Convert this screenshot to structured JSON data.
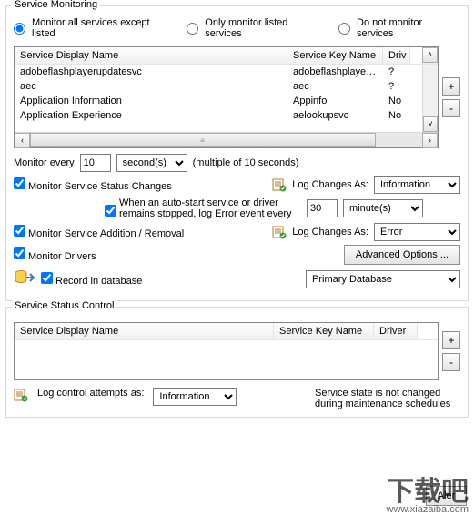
{
  "monitoring": {
    "legend": "Service Monitoring",
    "radios": {
      "except": "Monitor all services except listed",
      "only": "Only monitor listed services",
      "none": "Do not monitor services"
    },
    "table": {
      "headers": {
        "name": "Service Display Name",
        "key": "Service Key Name",
        "driver": "Driv"
      },
      "rows": [
        {
          "name": "adobeflashplayerupdatesvc",
          "key": "adobeflashplayerupd...",
          "driver": "?"
        },
        {
          "name": "aec",
          "key": "aec",
          "driver": "?"
        },
        {
          "name": "Application Information",
          "key": "Appinfo",
          "driver": "No"
        },
        {
          "name": "Application Experience",
          "key": "aelookupsvc",
          "driver": "No"
        }
      ]
    },
    "interval": {
      "label_before": "Monitor every",
      "value": "10",
      "unit": "second(s)",
      "label_after": "(multiple of 10 seconds)"
    },
    "status_changes": {
      "label": "Monitor Service Status Changes",
      "log_label": "Log Changes As:",
      "log_level": "Information"
    },
    "autostart": {
      "label": "When an auto-start service or driver remains stopped, log Error event every",
      "value": "30",
      "unit": "minute(s)"
    },
    "add_remove": {
      "label": "Monitor Service Addition / Removal",
      "log_label": "Log Changes As:",
      "log_level": "Error"
    },
    "drivers": {
      "label": "Monitor Drivers"
    },
    "advanced_btn": "Advanced Options ...",
    "record_db": {
      "label": "Record in database",
      "db": "Primary Database"
    }
  },
  "status_control": {
    "legend": "Service Status Control",
    "table": {
      "headers": {
        "name": "Service Display Name",
        "key": "Service Key Name",
        "driver": "Driver"
      }
    },
    "log_attempts": {
      "label": "Log control attempts as:",
      "level": "Information"
    },
    "note": "Service state is not changed during maintenance schedules",
    "aler_btn": "Aler"
  },
  "watermark": {
    "big": "下载吧",
    "small": "www.xiazaiba.com"
  }
}
